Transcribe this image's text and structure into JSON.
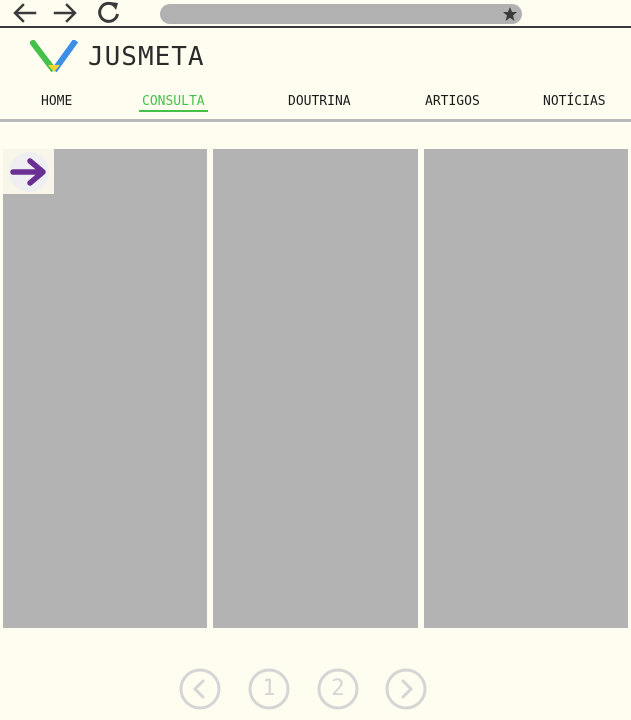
{
  "browser": {
    "back_icon": "arrow-left-icon",
    "forward_icon": "arrow-right-icon",
    "reload_icon": "reload-icon",
    "bookmark_icon": "star-icon",
    "url_value": ""
  },
  "brand": {
    "name": "JUSMETA",
    "mark_colors": [
      "#45c14b",
      "#f6d433",
      "#3b8fe6"
    ]
  },
  "menu": {
    "items": [
      {
        "label": "HOME",
        "active": false
      },
      {
        "label": "CONSULTA",
        "active": true
      },
      {
        "label": "DOUTRINA",
        "active": false
      },
      {
        "label": "ARTIGOS",
        "active": false
      },
      {
        "label": "NOTÍCIAS",
        "active": false
      }
    ]
  },
  "content": {
    "panels": 3,
    "next_icon": "arrow-right-icon"
  },
  "pagination": {
    "prev_icon": "chevron-left-icon",
    "pages": [
      "1",
      "2"
    ],
    "next_icon": "chevron-right-icon"
  },
  "colors": {
    "background": "#fefdf0",
    "accent": "#45c14b",
    "placeholder": "#b3b3b3",
    "arrow_button": "#6a2f93"
  }
}
